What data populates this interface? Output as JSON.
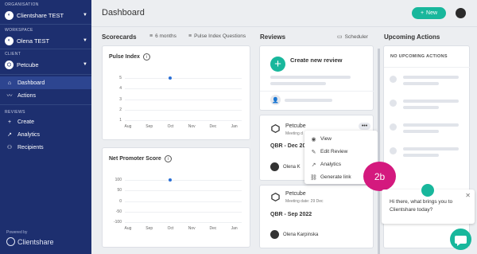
{
  "sidebar": {
    "org_section": "ORGANISATION",
    "org_name": "Clientshare TEST",
    "workspace_section": "WORKSPACE",
    "workspace_name": "Olena TEST",
    "client_section": "CLIENT",
    "client_name": "Petcube",
    "nav": [
      {
        "label": "Dashboard",
        "icon": "home-icon",
        "active": true
      },
      {
        "label": "Actions",
        "icon": "pulse-icon",
        "active": false
      }
    ],
    "reviews_section": "REVIEWS",
    "reviews_nav": [
      {
        "label": "Create",
        "icon": "plus-icon"
      },
      {
        "label": "Analytics",
        "icon": "chart-icon"
      },
      {
        "label": "Recipients",
        "icon": "users-icon"
      }
    ],
    "powered_by": "Powered by",
    "brand": "Clientshare"
  },
  "header": {
    "title": "Dashboard",
    "new_button": "New"
  },
  "scorecards": {
    "title": "Scorecards",
    "filter_period": "6 months",
    "filter_questions": "Pulse Index Questions",
    "pulse": {
      "title": "Pulse Index",
      "chart_data": {
        "type": "scatter",
        "categories": [
          "Aug",
          "Sep",
          "Oct",
          "Nov",
          "Dec",
          "Jan"
        ],
        "y_ticks": [
          1,
          2,
          3,
          4,
          5
        ],
        "ylim": [
          1,
          5
        ],
        "points": [
          {
            "x": "Oct",
            "y": 5
          }
        ]
      }
    },
    "nps": {
      "title": "Net Promoter Score",
      "chart_data": {
        "type": "scatter",
        "categories": [
          "Aug",
          "Sep",
          "Oct",
          "Nov",
          "Dec",
          "Jan"
        ],
        "y_ticks": [
          -100,
          -50,
          0,
          50,
          100
        ],
        "ylim": [
          -100,
          100
        ],
        "points": [
          {
            "x": "Oct",
            "y": 100
          }
        ]
      }
    }
  },
  "reviews": {
    "title": "Reviews",
    "scheduler": "Scheduler",
    "create_label": "Create new review",
    "cards": [
      {
        "client": "Petcube",
        "meeting": "Meeting d",
        "qbr": "QBR - Dec 20",
        "person": "Olena K"
      },
      {
        "client": "Petcube",
        "meeting": "Meeting date: 29 Dec",
        "qbr": "QBR - Sep 2022",
        "person": "Olena Karpinska"
      }
    ],
    "menu": [
      {
        "label": "View",
        "icon": "eye-icon"
      },
      {
        "label": "Edit Review",
        "icon": "edit-icon"
      },
      {
        "label": "Analytics",
        "icon": "chart-icon"
      },
      {
        "label": "Generate link",
        "icon": "link-icon"
      }
    ]
  },
  "upcoming": {
    "title": "Upcoming Actions",
    "empty": "NO UPCOMING ACTIONS"
  },
  "step_badge": "2b",
  "chat": {
    "message": "Hi there, what brings you to Clientshare today?"
  },
  "colors": {
    "sidebar": "#1d2f6f",
    "accent": "#18b79c",
    "badge": "#d4197e",
    "data_point": "#2a6fd6"
  }
}
